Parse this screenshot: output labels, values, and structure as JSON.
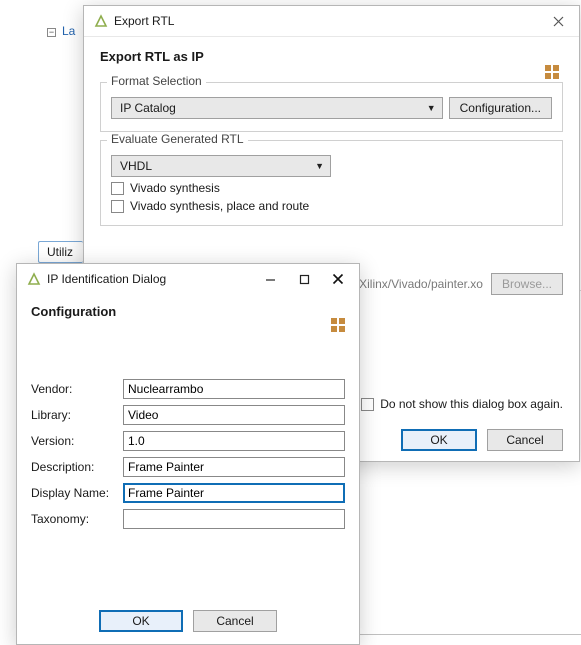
{
  "background": {
    "tree_item_partial": "La",
    "utilization_button_partial": "Utiliz"
  },
  "export_dialog": {
    "title": "Export RTL",
    "heading": "Export RTL as IP",
    "format_section": {
      "legend": "Format Selection",
      "format_value": "IP Catalog",
      "configuration_button": "Configuration..."
    },
    "evaluate_section": {
      "legend": "Evaluate Generated RTL",
      "language_value": "VHDL",
      "synth_checkbox": "Vivado synthesis",
      "synth_par_checkbox": "Vivado synthesis, place and route"
    },
    "output_path_partial": "Xilinx/Vivado/painter.xo",
    "browse_button": "Browse...",
    "do_not_show_checkbox": "Do not show this dialog box again.",
    "ok_button": "OK",
    "cancel_button": "Cancel"
  },
  "ip_dialog": {
    "title": "IP Identification Dialog",
    "heading": "Configuration",
    "fields": {
      "vendor": {
        "label": "Vendor:",
        "value": "Nuclearrambo"
      },
      "library": {
        "label": "Library:",
        "value": "Video"
      },
      "version": {
        "label": "Version:",
        "value": "1.0"
      },
      "description": {
        "label": "Description:",
        "value": "Frame Painter"
      },
      "display_name": {
        "label": "Display Name:",
        "value": "Frame Painter"
      },
      "taxonomy": {
        "label": "Taxonomy:",
        "value": ""
      }
    },
    "ok_button": "OK",
    "cancel_button": "Cancel"
  }
}
